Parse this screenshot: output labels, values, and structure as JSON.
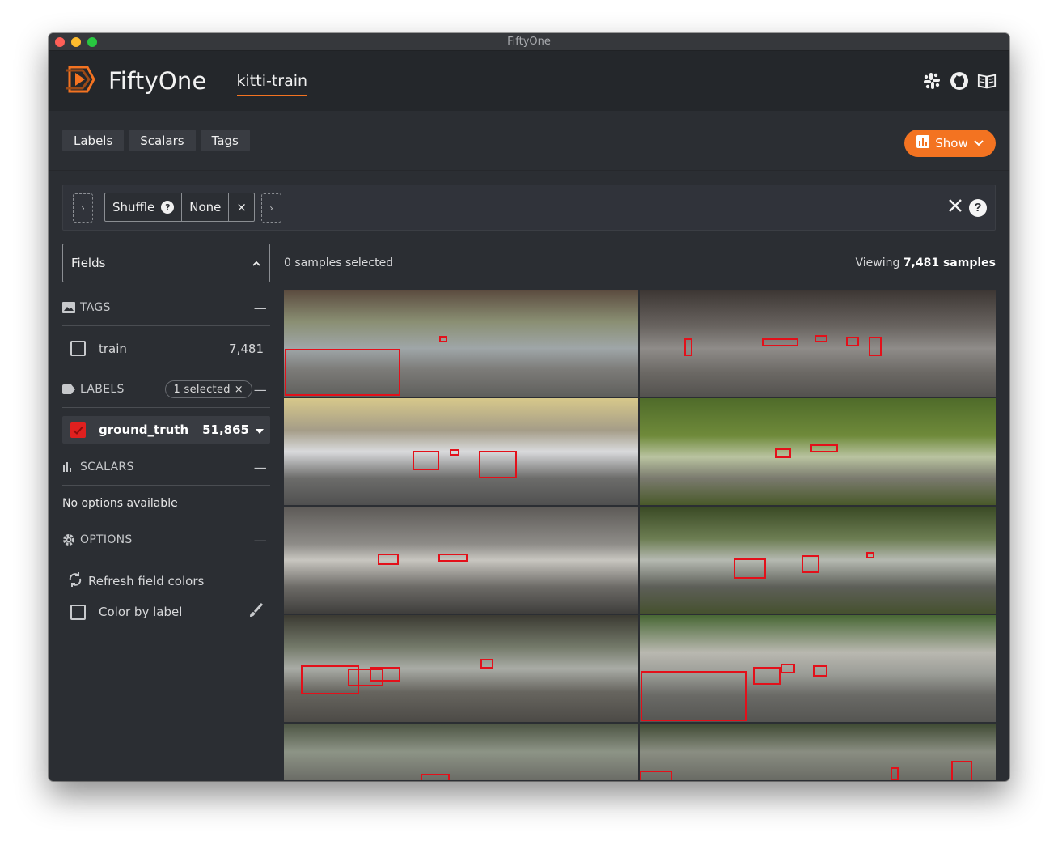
{
  "window": {
    "title": "FiftyOne"
  },
  "header": {
    "app_name": "FiftyOne",
    "dataset": "kitti-train",
    "icons": [
      "slack-icon",
      "github-icon",
      "docs-book-icon"
    ]
  },
  "toolbar": {
    "tabs": [
      "Labels",
      "Scalars",
      "Tags"
    ],
    "show_label": "Show"
  },
  "view_bar": {
    "stage_name": "Shuffle",
    "stage_value": "None",
    "clear_icon": "x-icon",
    "help_icon": "question-icon"
  },
  "sidebar": {
    "fields_label": "Fields",
    "tags": {
      "title": "TAGS",
      "items": [
        {
          "label": "train",
          "count": "7,481"
        }
      ]
    },
    "labels": {
      "title": "LABELS",
      "selected_pill": "1 selected",
      "items": [
        {
          "label": "ground_truth",
          "count": "51,865",
          "checked": true
        }
      ]
    },
    "scalars": {
      "title": "SCALARS",
      "empty_text": "No options available"
    },
    "options": {
      "title": "OPTIONS",
      "refresh_label": "Refresh field colors",
      "color_by_label": "Color by label"
    }
  },
  "main": {
    "selected_text": "0 samples selected",
    "viewing_prefix": "Viewing",
    "viewing_count": "7,481 samples"
  },
  "colors": {
    "accent": "#f37321",
    "label_box": "#e3101a",
    "background": "#2b2e33"
  }
}
